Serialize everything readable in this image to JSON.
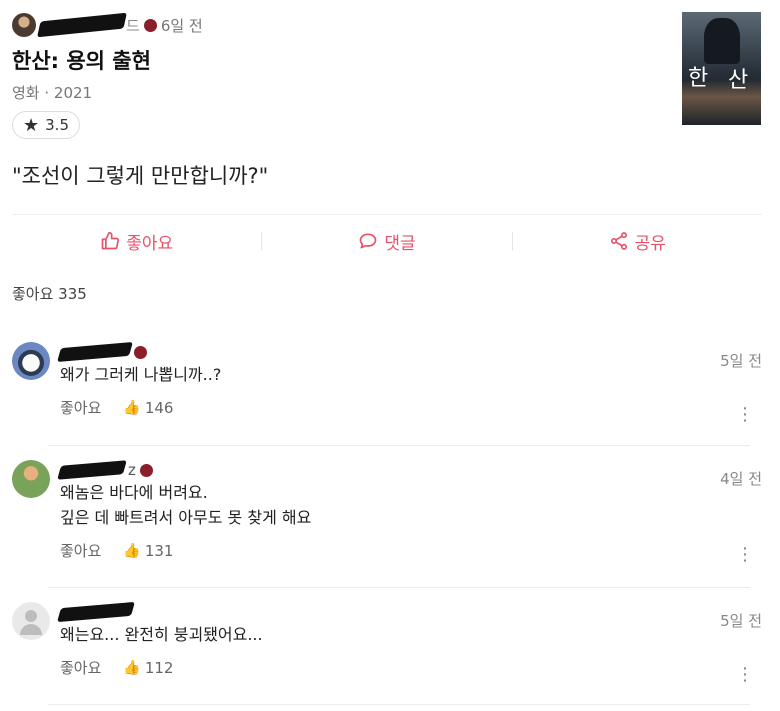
{
  "post": {
    "author_tail": "드",
    "time_ago": "6일 전",
    "movie_title": "한산: 용의 출현",
    "movie_meta": "영화 · 2021",
    "rating": "3.5",
    "poster_chars": [
      "한",
      "산"
    ],
    "review_text": "\"조선이 그렇게 만만합니까?\""
  },
  "actions": {
    "like": "좋아요",
    "comment": "댓글",
    "share": "공유"
  },
  "like_count_label": "좋아요 335",
  "comments": [
    {
      "time": "5일 전",
      "text_lines": [
        "왜가 그러케 나뽑니까..?"
      ],
      "like_label": "좋아요",
      "likes": "146"
    },
    {
      "time": "4일 전",
      "text_lines": [
        "왜놈은 바다에 버려요.",
        "깊은 데 빠트려서 아무도 못 찾게 해요"
      ],
      "like_label": "좋아요",
      "likes": "131"
    },
    {
      "time": "5일 전",
      "text_lines": [
        "왜는요... 완전히 붕괴됐어요..."
      ],
      "like_label": "좋아요",
      "likes": "112"
    }
  ],
  "colors": {
    "accent": "#e7526a",
    "badge": "#8b1e2b"
  }
}
